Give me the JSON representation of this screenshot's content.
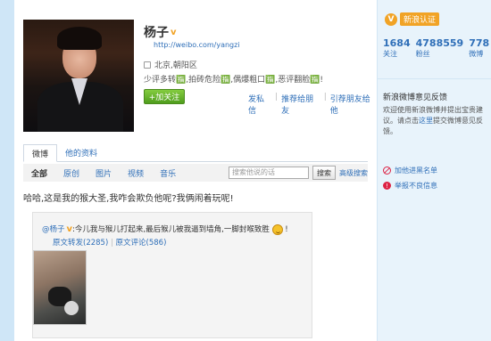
{
  "profile": {
    "name": "杨子",
    "verified_mark": "v",
    "url": "http://weibo.com/yangzi",
    "location": "北京,朝阳区",
    "bio": "少评多转🈯,拍砖危险🈯,偶爆粗口🈯,恶评翻脸🈯!",
    "follow_label": "+加关注",
    "actions": [
      "发私信",
      "推荐给朋友",
      "引荐朋友给他"
    ]
  },
  "tabs": [
    "微博",
    "他的资料"
  ],
  "filter": {
    "items": [
      "全部",
      "原创",
      "图片",
      "视频",
      "音乐"
    ],
    "search_placeholder": "搜索他说的话",
    "search_button": "搜索",
    "advanced_search": "高级搜索"
  },
  "post": {
    "text": "哈哈,这是我的猴大圣,我咋会欺负他呢?我俩闹着玩呢!",
    "repost": {
      "author": "@杨子",
      "author_mark": "v",
      "text": ":今儿我与猴儿打起来,最后猴儿被我逼到墙角,一脚封喉致胜",
      "suffix": "!",
      "forward_link": "原文转发(2285)",
      "separator": " | ",
      "comment_link": "原文评论(586)"
    }
  },
  "sidebar": {
    "verify_label": "新浪认证",
    "stats": [
      {
        "value": "1684",
        "label": "关注"
      },
      {
        "value": "4788559",
        "label": "粉丝"
      },
      {
        "value": "778",
        "label": "微博"
      }
    ],
    "feedback_title": "新浪微博意见反馈",
    "feedback_text_1": "欢迎使用新浪微博并提出宝贵建议。请点击",
    "feedback_link": "这里",
    "feedback_text_2": "提交微博意见反馈。",
    "blacklist_label": "加他进黑名单",
    "report_label": "举报不良信息"
  },
  "colors": {
    "accent": "#2f6fb8",
    "verify": "#f1a326",
    "follow": "#5ca82a"
  }
}
